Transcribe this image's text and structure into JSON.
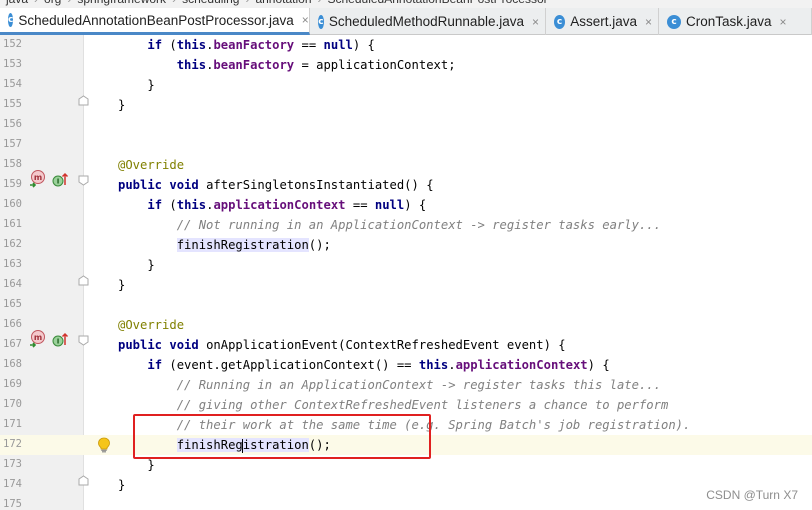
{
  "breadcrumb": {
    "items": [
      "java",
      "org",
      "springframework",
      "scheduling",
      "annotation",
      "ScheduledAnnotationBeanPostProcessor"
    ]
  },
  "tabs": [
    {
      "label": "ScheduledAnnotationBeanPostProcessor.java",
      "active": true,
      "icon": "class-icon"
    },
    {
      "label": "ScheduledMethodRunnable.java",
      "active": false,
      "icon": "class-icon"
    },
    {
      "label": "Assert.java",
      "active": false,
      "icon": "class-icon"
    },
    {
      "label": "CronTask.java",
      "active": false,
      "icon": "class-icon"
    }
  ],
  "tab_close_glyph": "×",
  "editor": {
    "current_line": "172",
    "lines": [
      {
        "num": "152"
      },
      {
        "num": "153"
      },
      {
        "num": "154"
      },
      {
        "num": "155"
      },
      {
        "num": "156"
      },
      {
        "num": "157"
      },
      {
        "num": "158"
      },
      {
        "num": "159"
      },
      {
        "num": "160"
      },
      {
        "num": "161"
      },
      {
        "num": "162"
      },
      {
        "num": "163"
      },
      {
        "num": "164"
      },
      {
        "num": "165"
      },
      {
        "num": "166"
      },
      {
        "num": "167"
      },
      {
        "num": "168"
      },
      {
        "num": "169"
      },
      {
        "num": "170"
      },
      {
        "num": "171"
      },
      {
        "num": "172"
      },
      {
        "num": "173"
      },
      {
        "num": "174"
      },
      {
        "num": "175"
      }
    ],
    "code": {
      "l152": {
        "indent": "    ",
        "kw_if": "if",
        "open": " (",
        "kw_this": "this",
        "dot": ".",
        "field": "beanFactory",
        "eq": " == ",
        "kw_null": "null",
        "close": ") {"
      },
      "l153": {
        "indent": "        ",
        "kw_this": "this",
        "dot": ".",
        "field": "beanFactory",
        "rest": " = applicationContext;"
      },
      "l154": {
        "text": "    }"
      },
      "l155": {
        "text": "}"
      },
      "l158": {
        "annotation": "@Override"
      },
      "l159": {
        "kw_public": "public",
        "kw_void": "void",
        "rest": " afterSingletonsInstantiated() {"
      },
      "l160": {
        "indent": "    ",
        "kw_if": "if",
        "open": " (",
        "kw_this": "this",
        "dot": ".",
        "field": "applicationContext",
        "eq": " == ",
        "kw_null": "null",
        "close": ") {"
      },
      "l161": {
        "indent": "        ",
        "comment": "// Not running in an ApplicationContext -> register tasks early..."
      },
      "l162": {
        "indent": "        ",
        "method": "finishRegistration",
        "rest": "();"
      },
      "l163": {
        "text": "    }"
      },
      "l164": {
        "text": "}"
      },
      "l166": {
        "annotation": "@Override"
      },
      "l167": {
        "kw_public": "public",
        "kw_void": "void",
        "rest": " onApplicationEvent(ContextRefreshedEvent event) {"
      },
      "l168": {
        "indent": "    ",
        "kw_if": "if",
        "mid": " (event.getApplicationContext() == ",
        "kw_this": "this",
        "dot": ".",
        "field": "applicationContext",
        "close": ") {"
      },
      "l169": {
        "indent": "        ",
        "comment": "// Running in an ApplicationContext -> register tasks this late..."
      },
      "l170": {
        "indent": "        ",
        "comment": "// giving other ContextRefreshedEvent listeners a chance to perform"
      },
      "l171": {
        "indent": "        ",
        "comment": "// their work at the same time (e.g. Spring Batch's job registration)."
      },
      "l172": {
        "indent": "        ",
        "method_a": "finishReg",
        "method_b": "istration",
        "rest": "();"
      },
      "l173": {
        "text": "    }"
      },
      "l174": {
        "text": "}"
      }
    },
    "gutter_icons": {
      "override_badge": "m",
      "implements_badge": "I"
    }
  },
  "colors": {
    "keyword": "#000080",
    "field": "#660e7a",
    "annotation": "#808000",
    "comment": "#808080",
    "highlight_box": "#e02020",
    "tab_accent": "#4a88c7"
  },
  "watermark": "CSDN @Turn X7"
}
